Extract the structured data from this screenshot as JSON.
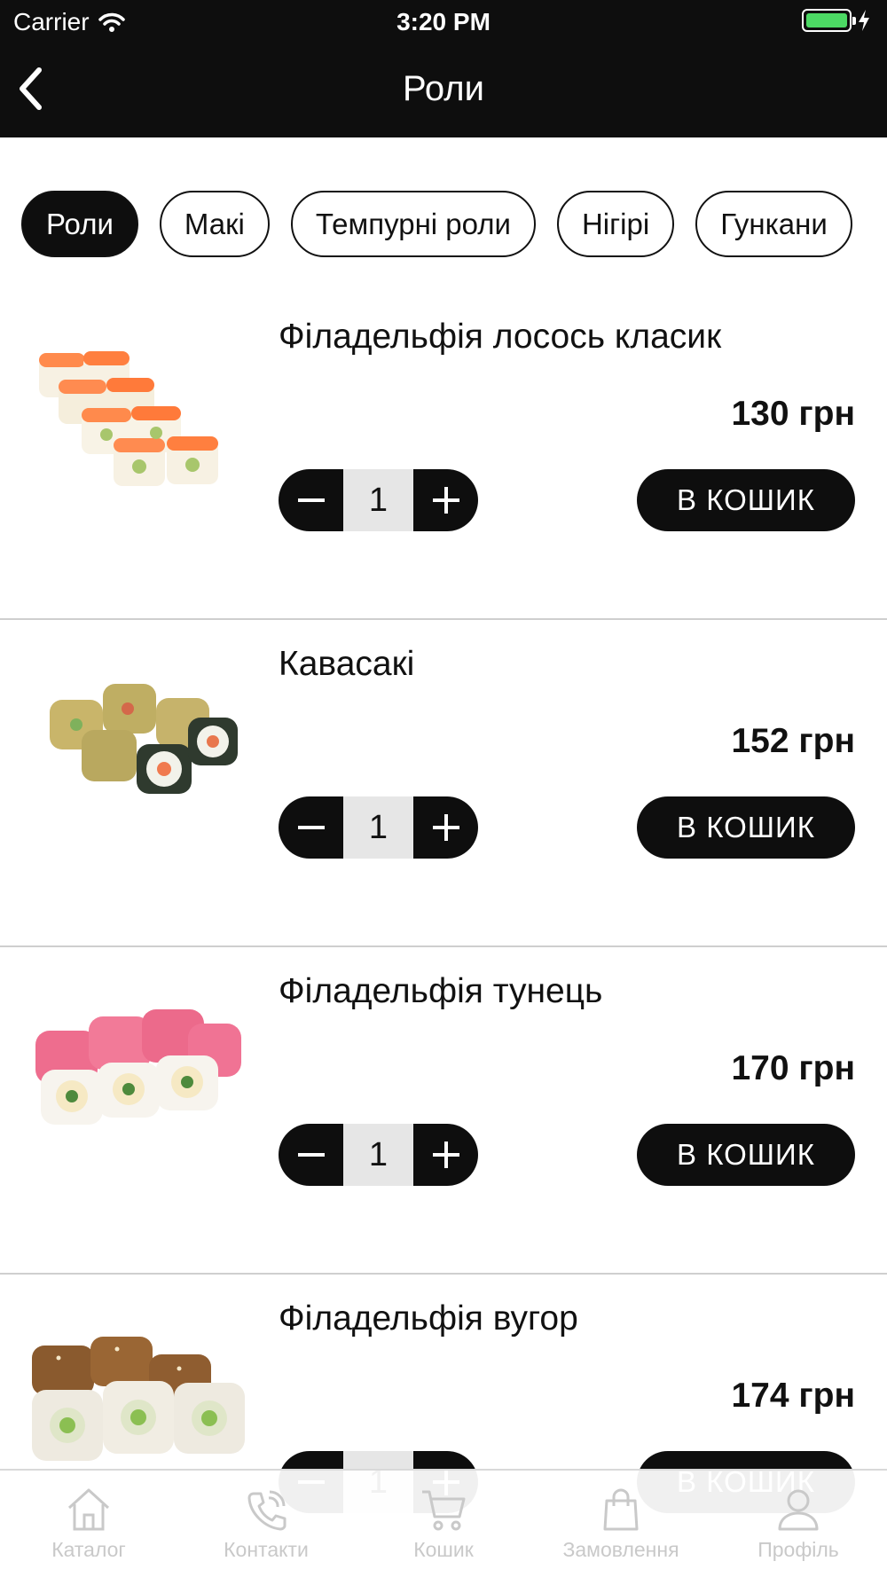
{
  "status_bar": {
    "carrier": "Carrier",
    "time": "3:20 PM"
  },
  "nav": {
    "title": "Роли"
  },
  "chips": [
    {
      "label": "Роли",
      "active": true
    },
    {
      "label": "Макі",
      "active": false
    },
    {
      "label": "Темпурні роли",
      "active": false
    },
    {
      "label": "Нігірі",
      "active": false
    },
    {
      "label": "Гункани",
      "active": false
    }
  ],
  "products": [
    {
      "name": "Філадельфія лосось класик",
      "price": "130 грн",
      "qty": "1",
      "cart_label": "В КОШИК",
      "image": "salmon-roll"
    },
    {
      "name": "Кавасакі",
      "price": "152 грн",
      "qty": "1",
      "cart_label": "В КОШИК",
      "image": "tempura-roll"
    },
    {
      "name": "Філадельфія тунець",
      "price": "170 грн",
      "qty": "1",
      "cart_label": "В КОШИК",
      "image": "tuna-roll"
    },
    {
      "name": "Філадельфія вугор",
      "price": "174 грн",
      "qty": "1",
      "cart_label": "В КОШИК",
      "image": "eel-roll"
    }
  ],
  "tabbar": [
    {
      "label": "Каталог",
      "icon": "home-icon"
    },
    {
      "label": "Контакти",
      "icon": "phone-icon"
    },
    {
      "label": "Кошик",
      "icon": "cart-icon"
    },
    {
      "label": "Замовлення",
      "icon": "bag-icon"
    },
    {
      "label": "Профіль",
      "icon": "user-icon"
    }
  ],
  "colors": {
    "bar": "#0e0e0e",
    "accent": "#0e0e0e",
    "battery": "#4cd964",
    "tab_inactive": "#c9c9c9",
    "stepper_bg": "#e6e6e6"
  }
}
